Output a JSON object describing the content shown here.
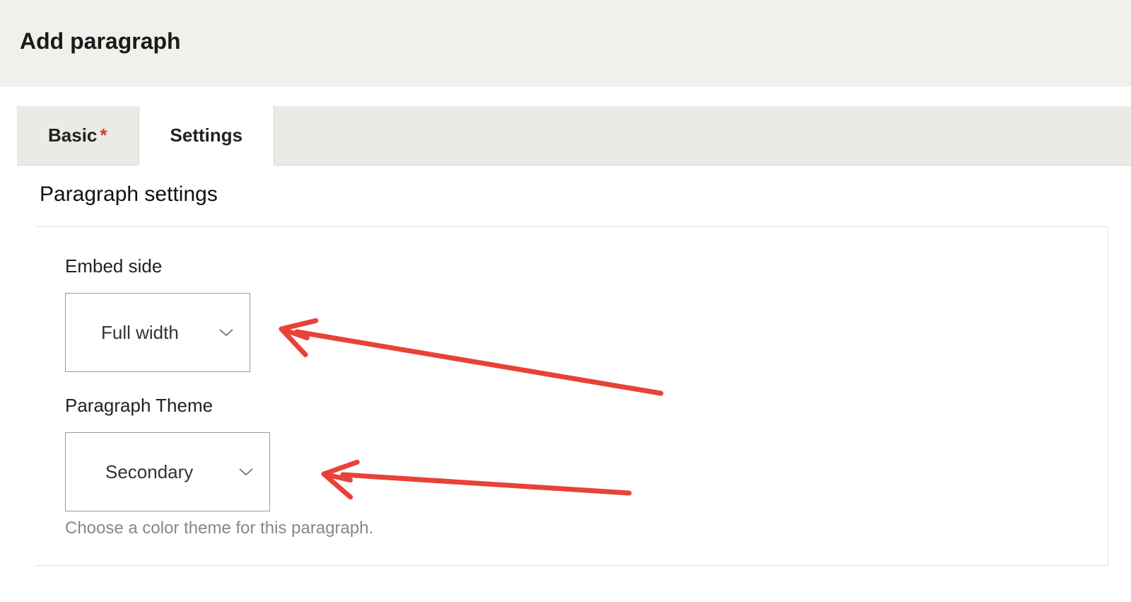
{
  "header": {
    "title": "Add paragraph"
  },
  "tabs": {
    "basic": {
      "label": "Basic",
      "required_marker": "*"
    },
    "settings": {
      "label": "Settings"
    }
  },
  "panel": {
    "title": "Paragraph settings",
    "fields": {
      "embed_side": {
        "label": "Embed side",
        "value": "Full width"
      },
      "paragraph_theme": {
        "label": "Paragraph Theme",
        "value": "Secondary",
        "help": "Choose a color theme for this paragraph."
      }
    }
  },
  "annotation_color": "#e84238"
}
